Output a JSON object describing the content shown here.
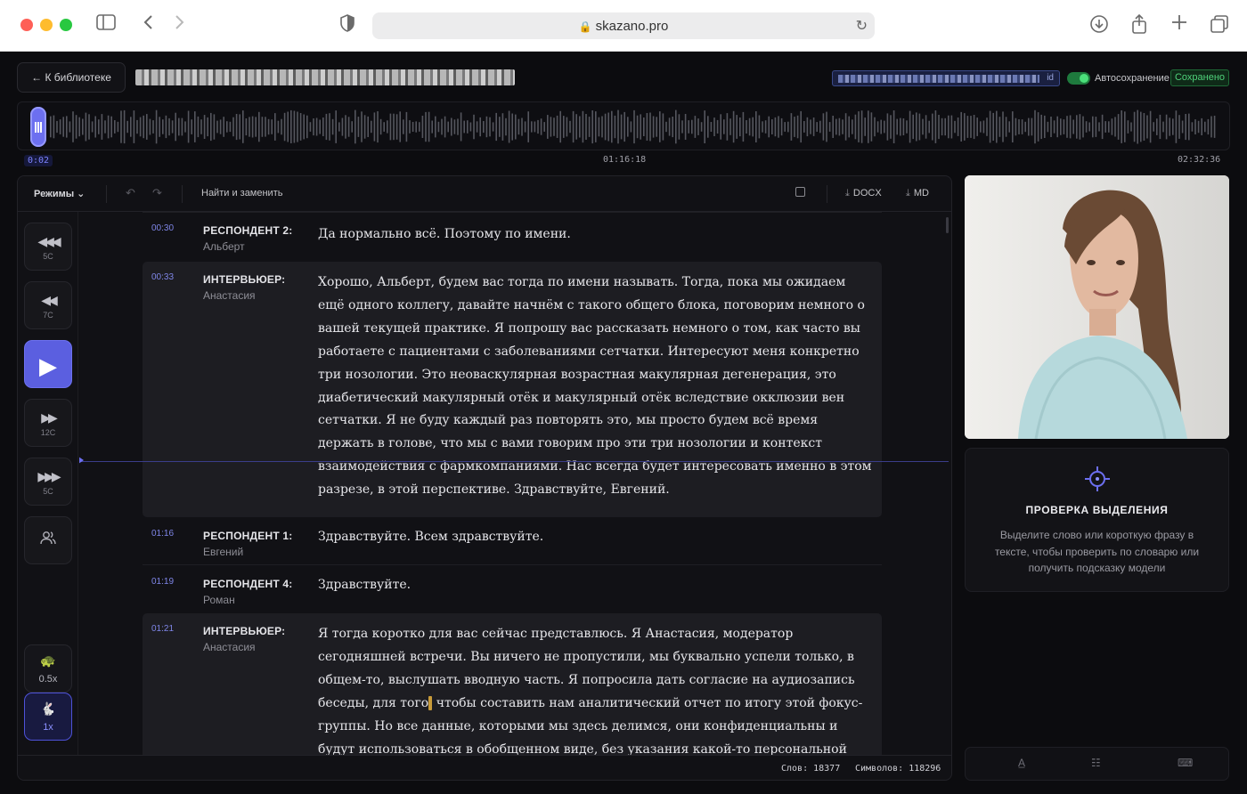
{
  "browser": {
    "url": "skazano.pro"
  },
  "topbar": {
    "back_label": "← К библиотеке",
    "file_title": "",
    "id_chip_suffix": "id",
    "autosave_label": "Автосохранение",
    "autosave_on": true,
    "saved_badge": "Сохранено"
  },
  "player": {
    "current_time": "0:02",
    "mid_time": "01:16:18",
    "end_time": "02:32:36",
    "progress_fraction": 0.0002
  },
  "toolbar": {
    "modes_label": "Режимы ⌄",
    "find_replace_label": "Найти и заменить",
    "export_docx": "DOCX",
    "export_md": "MD"
  },
  "controls": {
    "rewind_long_label": "5С",
    "rewind_short_label": "7С",
    "forward_short_label": "12С",
    "forward_long_label": "5С",
    "speed_slow_label": "0.5x",
    "speed_normal_label": "1x"
  },
  "transcript": [
    {
      "time": "00:30",
      "role": "РЕСПОНДЕНТ 2:",
      "name": "Альберт",
      "text": "Да нормально всё. Поэтому по имени."
    },
    {
      "time": "00:33",
      "role": "ИНТЕРВЬЮЕР:",
      "name": "Анастасия",
      "text": "Хорошо, Альберт, будем вас тогда по имени называть. Тогда, пока мы ожидаем ещё одного коллегу, давайте начнём с такого общего блока, поговорим немного о вашей текущей практике. Я попрошу вас рассказать немного о том, как часто вы работаете с пациентами с заболеваниями сетчатки. Интересуют меня конкретно три нозологии. Это неоваскулярная возрастная макулярная дегенерация, это диабетический макулярный отёк и макулярный отёк вследствие окклюзии вен сетчатки. Я не буду каждый раз повторять это, мы просто будем всё время держать в голове, что мы с вами говорим про эти три нозологии и контекст взаимодействия с фармкомпаниями. Нас всегда будет интересовать именно в этом разрезе, в этой перспективе. Здравствуйте, Евгений."
    },
    {
      "time": "01:16",
      "role": "РЕСПОНДЕНТ 1:",
      "name": "Евгений",
      "text": "Здравствуйте. Всем здравствуйте."
    },
    {
      "time": "01:19",
      "role": "РЕСПОНДЕНТ 4:",
      "name": "Роман",
      "text": "Здравствуйте."
    },
    {
      "time": "01:21",
      "role": "ИНТЕРВЬЮЕР:",
      "name": "Анастасия",
      "text_before_caret": "Я тогда коротко для вас сейчас представлюсь. Я Анастасия, модератор сегодняшней встречи. Вы ничего не пропустили, мы буквально успели только, в общем-то, выслушать вводную часть. Я попросила дать согласие на аудиозапись беседы, для того",
      "text_after_caret": " чтобы составить нам аналитический отчет по итогу этой фокус-группы. Но все данные, которыми мы здесь делимся, они конфиденциальны и будут использоваться в обобщенном виде, без указания какой-то персональной информации. Вы согласны"
    }
  ],
  "status": {
    "words": "Слов: 18377",
    "chars": "Символов: 118296"
  },
  "check_panel": {
    "title": "ПРОВЕРКА ВЫДЕЛЕНИЯ",
    "description": "Выделите слово или короткую фразу в тексте, чтобы проверить по словарю или получить подсказку модели"
  },
  "colors": {
    "accent": "#6c6ff0",
    "timestamp": "#7f86e8",
    "saved_green": "#4fd17a",
    "background": "#0c0c0f"
  }
}
